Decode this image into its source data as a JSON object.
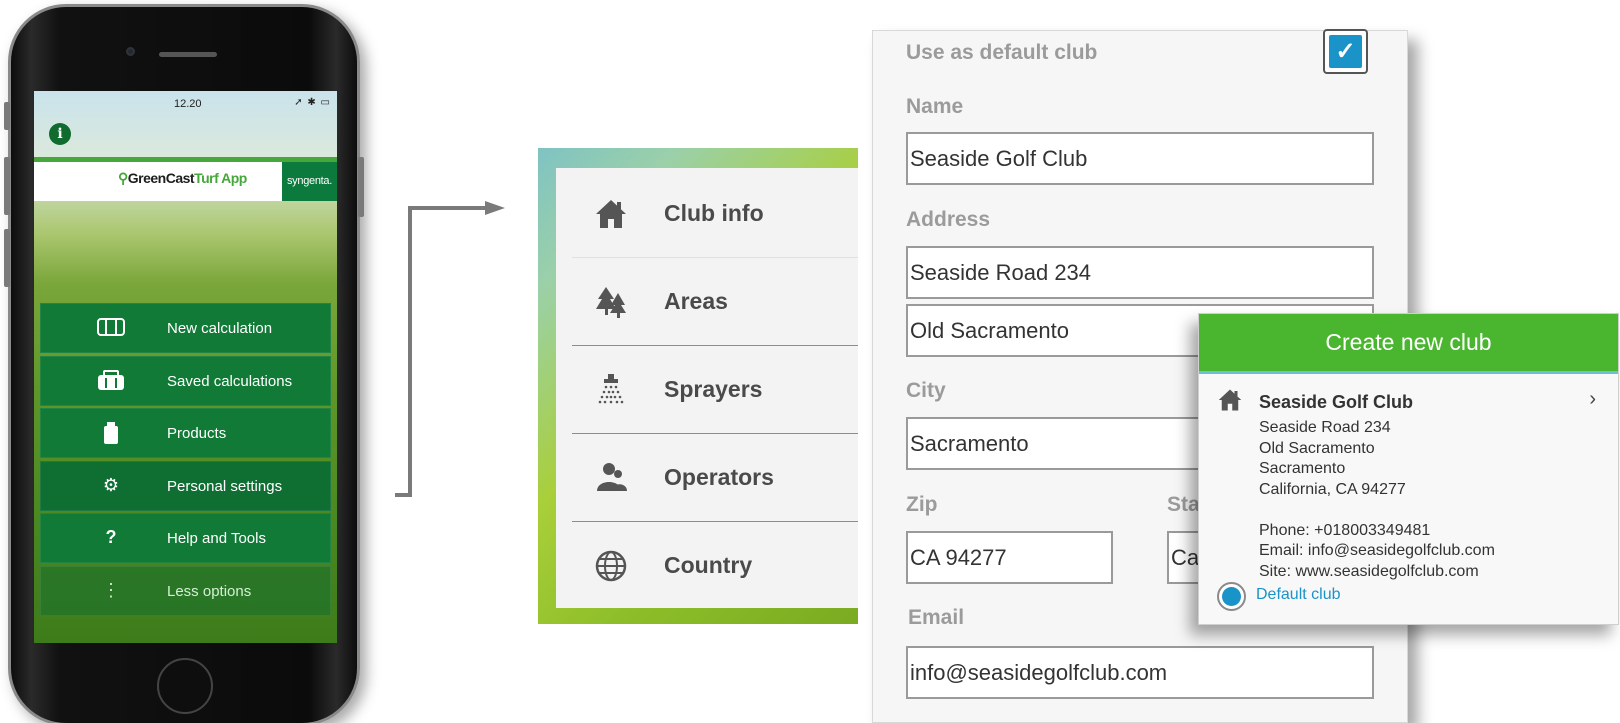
{
  "phone": {
    "status_time": "12.20",
    "brand": {
      "green": "GreenCast",
      "turf": "Turf App",
      "partner": "syngenta."
    },
    "menu": [
      {
        "icon": "calculator-icon",
        "glyph": "◫",
        "label": "New calculation"
      },
      {
        "icon": "saved-calculations-icon",
        "glyph": "▣",
        "label": "Saved calculations"
      },
      {
        "icon": "product-bottle-icon",
        "glyph": "▮",
        "label": "Products"
      },
      {
        "icon": "gear-icon",
        "glyph": "⚙",
        "label": "Personal settings"
      },
      {
        "icon": "question-icon",
        "glyph": "?",
        "label": "Help and Tools"
      },
      {
        "icon": "more-options-icon",
        "glyph": "⋮",
        "label": "Less options"
      }
    ]
  },
  "side_menu": {
    "items": [
      {
        "icon": "house-icon",
        "glyph": "🏠",
        "label": "Club info"
      },
      {
        "icon": "trees-icon",
        "glyph": "♣",
        "label": "Areas"
      },
      {
        "icon": "sprayer-icon",
        "glyph": "⛆",
        "label": "Sprayers"
      },
      {
        "icon": "operators-icon",
        "glyph": "👥",
        "label": "Operators"
      },
      {
        "icon": "globe-icon",
        "glyph": "🌐",
        "label": "Country"
      }
    ]
  },
  "form": {
    "default_club_label": "Use as default club",
    "default_club_checked": true,
    "name_label": "Name",
    "name_value": "Seaside Golf Club",
    "address_label": "Address",
    "address_line1": "Seaside Road 234",
    "address_line2": "Old Sacramento",
    "city_label": "City",
    "city_value": "Sacramento",
    "zip_label": "Zip",
    "zip_value": "CA 94277",
    "state_label": "Sta",
    "state_value": "Ca",
    "email_label": "Email",
    "email_value": "info@seasidegolfclub.com"
  },
  "card": {
    "header": "Create new club",
    "club_name": "Seaside Golf Club",
    "lines": [
      "Seaside Road 234",
      "Old Sacramento",
      "Sacramento",
      "California, CA 94277",
      "",
      "Phone: +018003349481",
      "Email: info@seasidegolfclub.com",
      "Site: www.seasidegolfclub.com"
    ],
    "default_label": "Default club"
  },
  "colors": {
    "brand_green": "#46a73a",
    "menu_green": "#107a36",
    "accent_blue": "#1a93c8",
    "card_header": "#4ab630"
  }
}
